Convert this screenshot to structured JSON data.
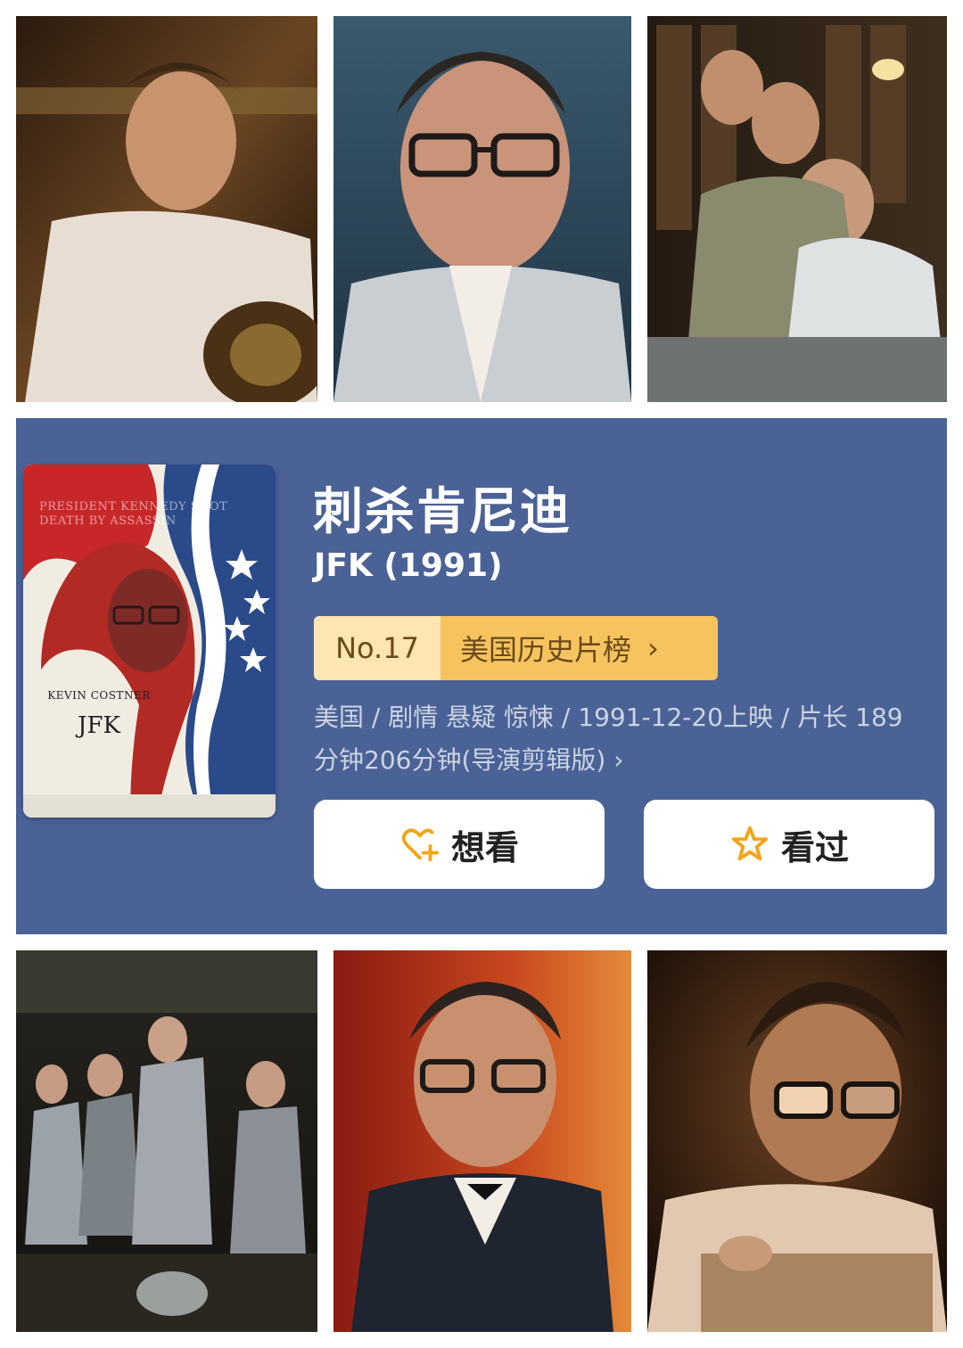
{
  "movie": {
    "title_zh": "刺杀肯尼迪",
    "title_en": "JFK (1991)",
    "rank": {
      "number": "No.17",
      "list_name": "美国历史片榜",
      "chevron": "›"
    },
    "meta_line": "美国 / 剧情 悬疑 惊悚 / 1991-12-20上映 / 片长 189分钟206分钟(导演剪辑版) ›",
    "poster": {
      "headline": "PRESIDENT KENNEDY SHOT DEATH BY ASSASSIN",
      "actor": "KEVIN COSTNER",
      "title": "JFK"
    }
  },
  "actions": {
    "want_label": "想看",
    "want_icon": "heart-plus-icon",
    "seen_label": "看过",
    "seen_icon": "star-outline-icon"
  },
  "colors": {
    "card_bg": "#4a6296",
    "rank_number_bg": "#fde6b3",
    "rank_list_bg": "#f6c45f",
    "icon_accent": "#f2a51a"
  }
}
